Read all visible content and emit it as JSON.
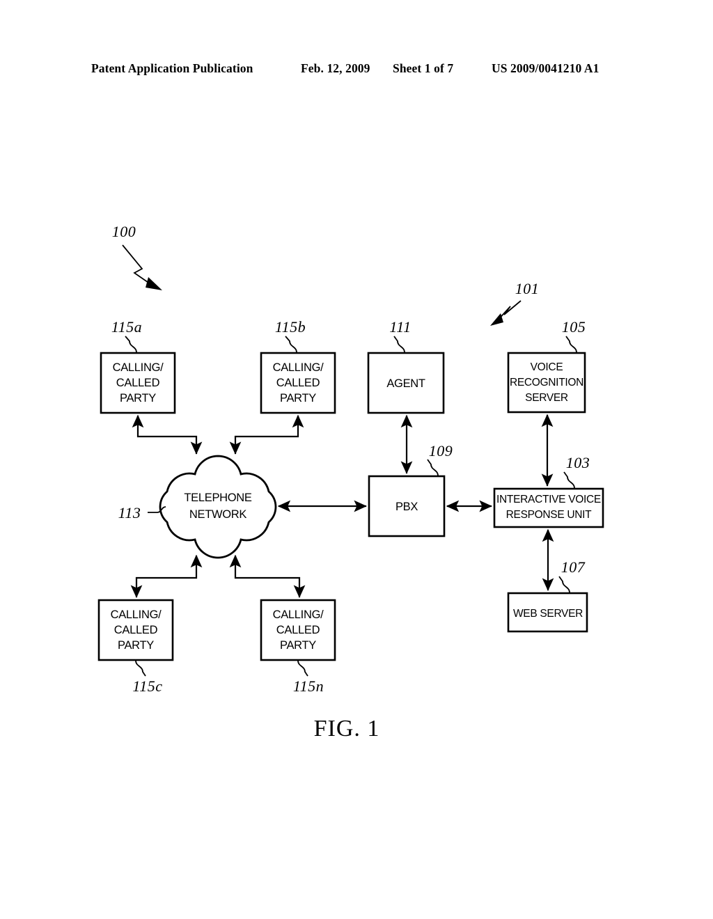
{
  "header": {
    "publication": "Patent Application Publication",
    "date": "Feb. 12, 2009",
    "sheet": "Sheet 1 of 7",
    "patent_number": "US 2009/0041210 A1"
  },
  "figure": {
    "caption": "FIG. 1",
    "system_ref": "100",
    "subsystem_ref": "101"
  },
  "nodes": {
    "party_a": {
      "ref": "115a",
      "lines": [
        "CALLING/",
        "CALLED",
        "PARTY"
      ]
    },
    "party_b": {
      "ref": "115b",
      "lines": [
        "CALLING/",
        "CALLED",
        "PARTY"
      ]
    },
    "party_c": {
      "ref": "115c",
      "lines": [
        "CALLING/",
        "CALLED",
        "PARTY"
      ]
    },
    "party_n": {
      "ref": "115n",
      "lines": [
        "CALLING/",
        "CALLED",
        "PARTY"
      ]
    },
    "agent": {
      "ref": "111",
      "lines": [
        "AGENT"
      ]
    },
    "voice_recognition_server": {
      "ref": "105",
      "lines": [
        "VOICE",
        "RECOGNITION",
        "SERVER"
      ]
    },
    "telephone_network": {
      "ref": "113",
      "lines": [
        "TELEPHONE",
        "NETWORK"
      ]
    },
    "pbx": {
      "ref": "109",
      "lines": [
        "PBX"
      ]
    },
    "ivr_unit": {
      "ref": "103",
      "lines": [
        "INTERACTIVE VOICE",
        "RESPONSE UNIT"
      ]
    },
    "web_server": {
      "ref": "107",
      "lines": [
        "WEB SERVER"
      ]
    }
  },
  "colors": {
    "ink": "#000000",
    "paper": "#ffffff"
  }
}
